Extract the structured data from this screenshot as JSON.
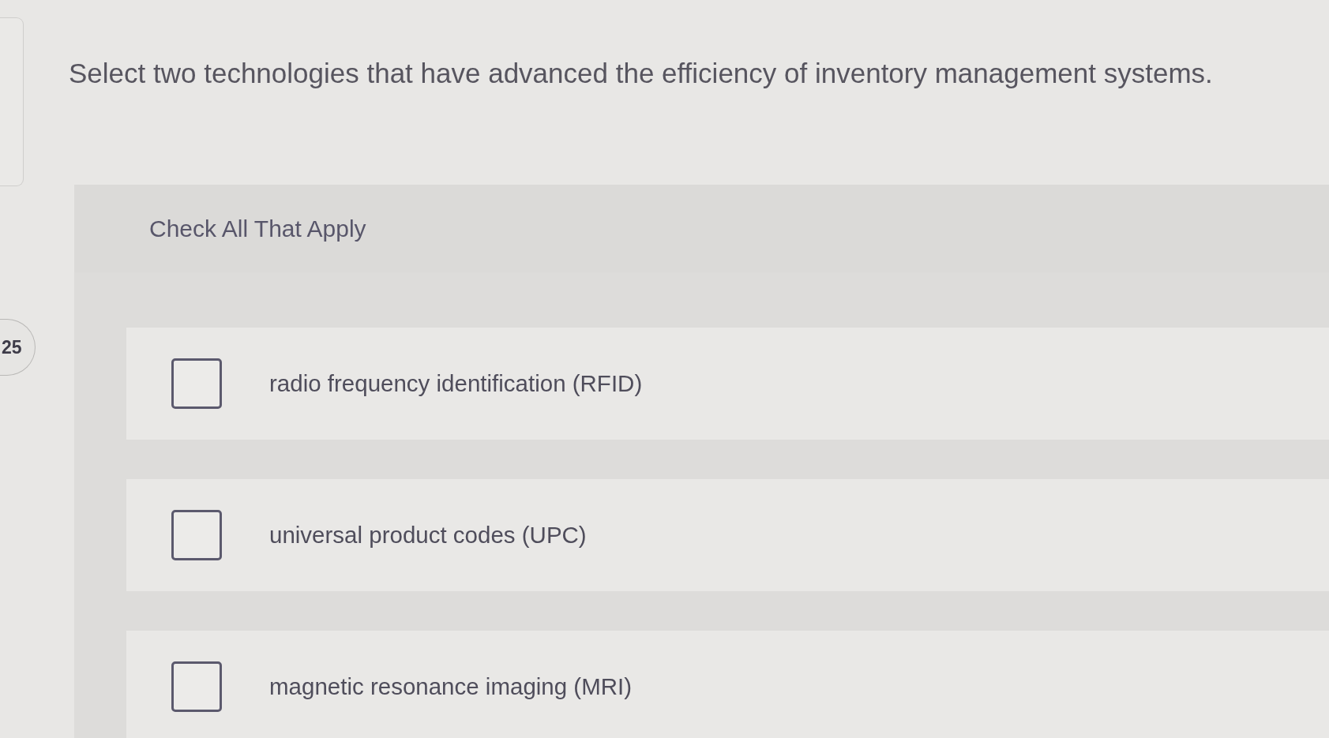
{
  "question": "Select two technologies that have advanced the efficiency of inventory management systems.",
  "question_number": "25",
  "instructions": "Check All That Apply",
  "options": [
    {
      "label": "radio frequency identification (RFID)",
      "checked": false
    },
    {
      "label": "universal product codes (UPC)",
      "checked": false
    },
    {
      "label": "magnetic resonance imaging (MRI)",
      "checked": false
    }
  ]
}
